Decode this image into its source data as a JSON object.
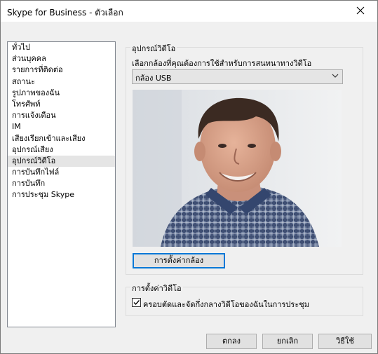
{
  "window": {
    "title": "Skype for Business - ตัวเลือก"
  },
  "nav": {
    "items": [
      {
        "label": "ทั่วไป"
      },
      {
        "label": "ส่วนบุคคล"
      },
      {
        "label": "รายการที่ติดต่อ"
      },
      {
        "label": "สถานะ"
      },
      {
        "label": "รูปภาพของฉัน"
      },
      {
        "label": "โทรศัพท์"
      },
      {
        "label": "การแจ้งเตือน"
      },
      {
        "label": "IM"
      },
      {
        "label": "เสียงเรียกเข้าและเสียง"
      },
      {
        "label": "อุปกรณ์เสียง"
      },
      {
        "label": "อุปกรณ์วิดีโอ"
      },
      {
        "label": "การบันทึกไฟล์"
      },
      {
        "label": "การบันทึก"
      },
      {
        "label": "การประชุม Skype"
      }
    ],
    "selected_index": 10
  },
  "video_device": {
    "group_title": "อุปกรณ์วิดีโอ",
    "instruction": "เลือกกล้องที่คุณต้องการใช้สำหรับการสนทนาทางวิดีโอ",
    "camera_select": {
      "value": "กล้อง USB",
      "icon": "chevron-down-icon"
    },
    "camera_settings_button": "การตั้งค่ากล้อง"
  },
  "video_settings": {
    "group_title": "การตั้งค่าวิดีโอ",
    "crop_checkbox": {
      "label": "ครอบตัดและจัดกึ่งกลางวิดีโอของฉันในการประชุม",
      "checked": true
    }
  },
  "footer": {
    "ok": "ตกลง",
    "cancel": "ยกเลิก",
    "help": "วิธีใช้"
  },
  "colors": {
    "focus_accent": "#0078d7",
    "selected_nav_bg": "#e5e5e5"
  }
}
